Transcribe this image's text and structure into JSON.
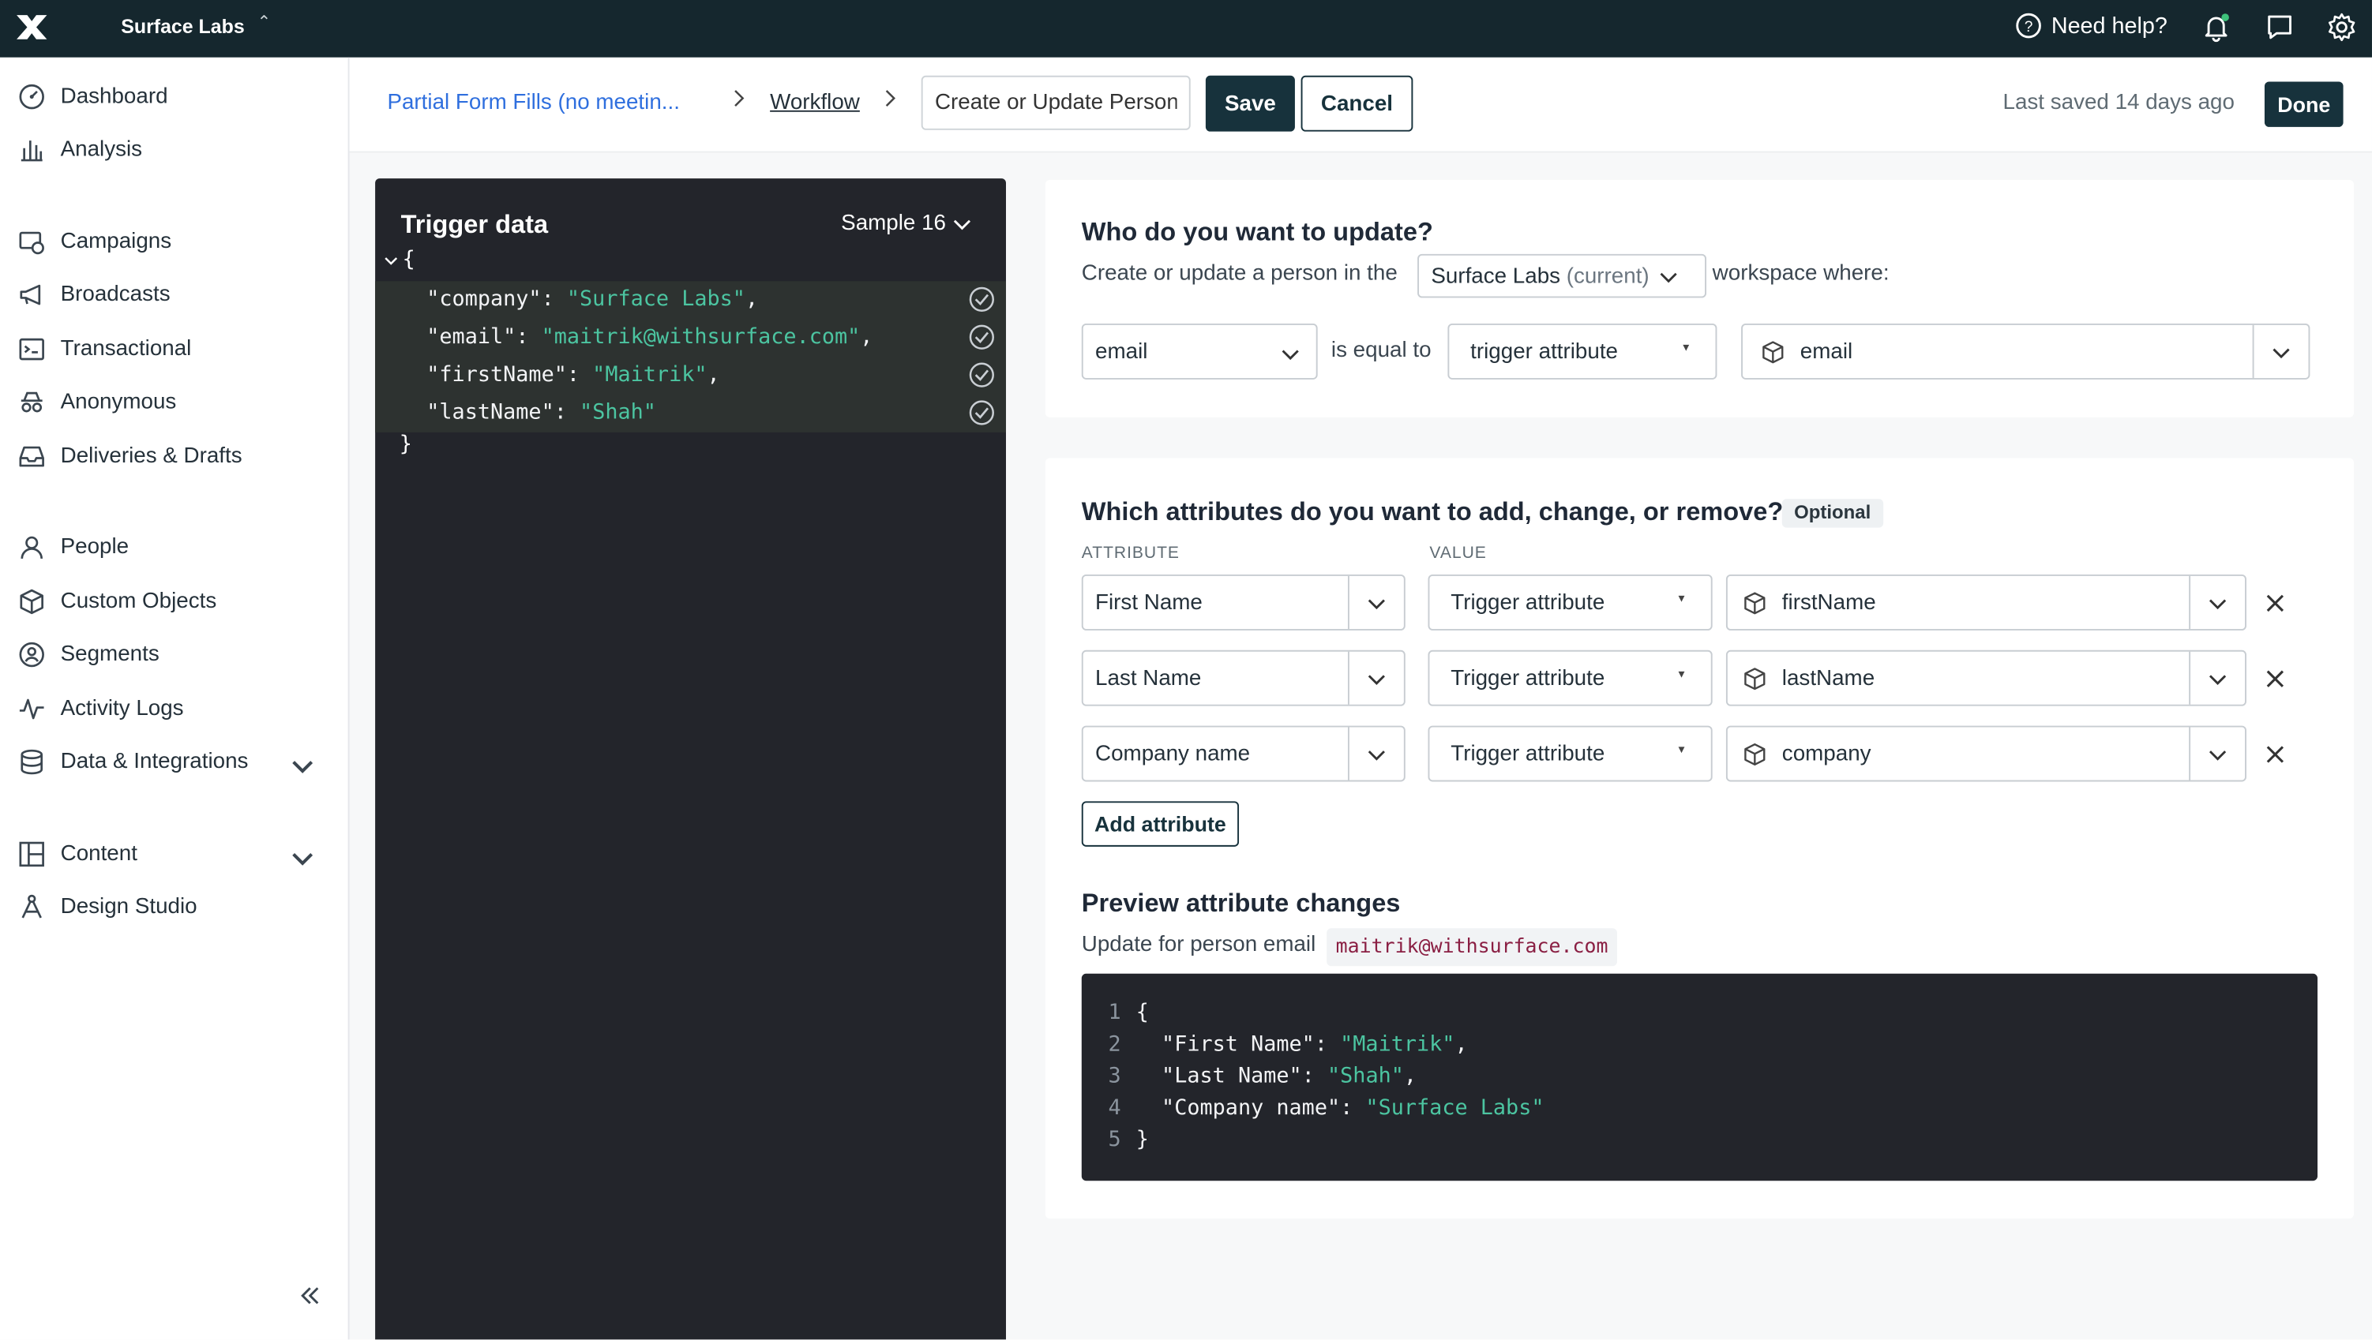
{
  "app": {
    "workspace_name": "Surface Labs",
    "help_label": "Need help?",
    "icons": [
      "logo-icon",
      "switch-icon",
      "help-icon",
      "bell-icon",
      "chat-icon",
      "gear-icon"
    ]
  },
  "sidebar": {
    "items": [
      {
        "label": "Dashboard",
        "icon": "dashboard-icon"
      },
      {
        "label": "Analysis",
        "icon": "analysis-icon"
      },
      {
        "label": "Campaigns",
        "icon": "campaigns-icon"
      },
      {
        "label": "Broadcasts",
        "icon": "broadcasts-icon"
      },
      {
        "label": "Transactional",
        "icon": "transactional-icon"
      },
      {
        "label": "Anonymous",
        "icon": "anonymous-icon"
      },
      {
        "label": "Deliveries & Drafts",
        "icon": "deliveries-icon"
      },
      {
        "label": "People",
        "icon": "people-icon"
      },
      {
        "label": "Custom Objects",
        "icon": "cube-icon"
      },
      {
        "label": "Segments",
        "icon": "segments-icon"
      },
      {
        "label": "Activity Logs",
        "icon": "activity-icon"
      },
      {
        "label": "Data & Integrations",
        "icon": "database-icon"
      },
      {
        "label": "Content",
        "icon": "content-icon"
      },
      {
        "label": "Design Studio",
        "icon": "design-icon"
      }
    ]
  },
  "header": {
    "breadcrumb_campaign": "Partial Form Fills (no meetin...",
    "breadcrumb_workflow": "Workflow",
    "action_name_value": "Create or Update Person",
    "save_label": "Save",
    "cancel_label": "Cancel",
    "last_saved": "Last saved 14 days ago",
    "done_label": "Done"
  },
  "trigger": {
    "title": "Trigger data",
    "sample_label": "Sample 16",
    "open_brace": "{",
    "close_brace": "}",
    "fields": [
      {
        "key": "\"company\"",
        "value": "\"Surface Labs\"",
        "trail": ","
      },
      {
        "key": "\"email\"",
        "value": "\"maitrik@withsurface.com\"",
        "trail": ","
      },
      {
        "key": "\"firstName\"",
        "value": "\"Maitrik\"",
        "trail": ","
      },
      {
        "key": "\"lastName\"",
        "value": "\"Shah\"",
        "trail": ""
      }
    ]
  },
  "who": {
    "title": "Who do you want to update?",
    "sentence_start": "Create or update a person in the",
    "workspace_value": "Surface Labs",
    "workspace_current": "(current)",
    "sentence_end": "workspace where:",
    "identifier": "email",
    "operator_text": "is equal to",
    "source": "trigger attribute",
    "source_value": "email"
  },
  "attributes": {
    "title": "Which attributes do you want to add, change, or remove?",
    "optional_badge": "Optional",
    "col_attribute": "ATTRIBUTE",
    "col_value": "VALUE",
    "rows": [
      {
        "attribute": "First Name",
        "source": "Trigger attribute",
        "value": "firstName"
      },
      {
        "attribute": "Last Name",
        "source": "Trigger attribute",
        "value": "lastName"
      },
      {
        "attribute": "Company name",
        "source": "Trigger attribute",
        "value": "company"
      }
    ],
    "add_label": "Add attribute"
  },
  "preview": {
    "title": "Preview attribute changes",
    "update_for": "Update for person email",
    "email": "maitrik@withsurface.com",
    "lines": [
      {
        "num": "1",
        "key": "{",
        "value": "",
        "trail": ""
      },
      {
        "num": "2",
        "key": "  \"First Name\": ",
        "value": "\"Maitrik\"",
        "trail": ","
      },
      {
        "num": "3",
        "key": "  \"Last Name\": ",
        "value": "\"Shah\"",
        "trail": ","
      },
      {
        "num": "4",
        "key": "  \"Company name\": ",
        "value": "\"Surface Labs\"",
        "trail": ""
      },
      {
        "num": "5",
        "key": "}",
        "value": "",
        "trail": ""
      }
    ]
  }
}
